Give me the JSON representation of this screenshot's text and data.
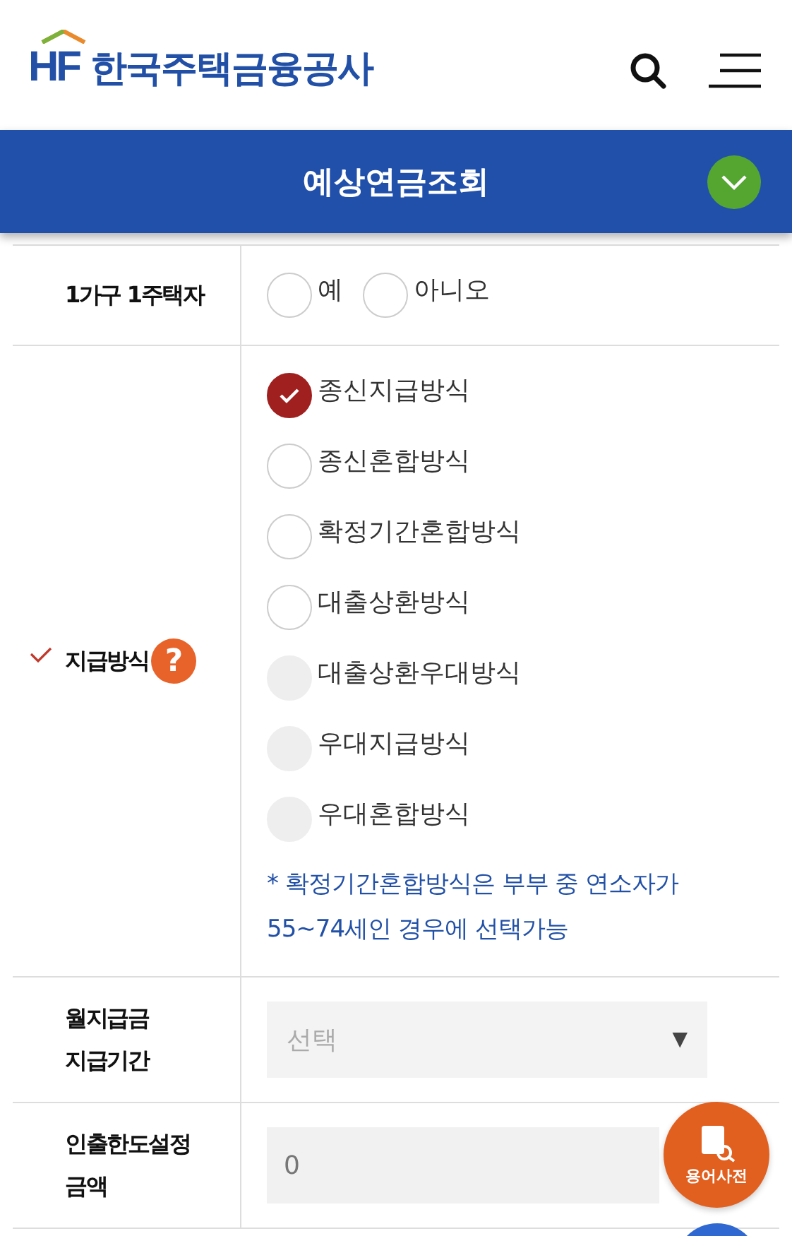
{
  "header": {
    "logo_mark": "HF",
    "logo_text": "한국주택금융공사"
  },
  "title_bar": {
    "title": "예상연금조회",
    "expanded": false
  },
  "form": [
    {
      "kind": "radio",
      "label": "1가구 1주택자",
      "required": false,
      "help": false,
      "options": [
        {
          "label": "예",
          "selected": false,
          "disabled": false
        },
        {
          "label": "아니오",
          "selected": false,
          "disabled": false
        }
      ]
    },
    {
      "kind": "radio",
      "label": "지급방식",
      "required": true,
      "help": true,
      "help_mark": "?",
      "options": [
        {
          "label": "종신지급방식",
          "selected": true,
          "disabled": false
        },
        {
          "label": "종신혼합방식",
          "selected": false,
          "disabled": false
        },
        {
          "label": "확정기간혼합방식",
          "selected": false,
          "disabled": false
        },
        {
          "label": "대출상환방식",
          "selected": false,
          "disabled": false
        },
        {
          "label": "대출상환우대방식",
          "selected": false,
          "disabled": true
        },
        {
          "label": "우대지급방식",
          "selected": false,
          "disabled": true
        },
        {
          "label": "우대혼합방식",
          "selected": false,
          "disabled": true
        }
      ],
      "note": "* 확정기간혼합방식은 부부 중 연소자가 55~74세인 경우에 선택가능"
    },
    {
      "kind": "select",
      "label": "월지급금 지급기간",
      "required": false,
      "help": false,
      "placeholder": "선택",
      "dropdown_mark": "▼"
    },
    {
      "kind": "input",
      "label": "인출한도설정 금액",
      "required": false,
      "help": false,
      "value": "0"
    }
  ],
  "floating_button": {
    "label": "용어사전"
  }
}
